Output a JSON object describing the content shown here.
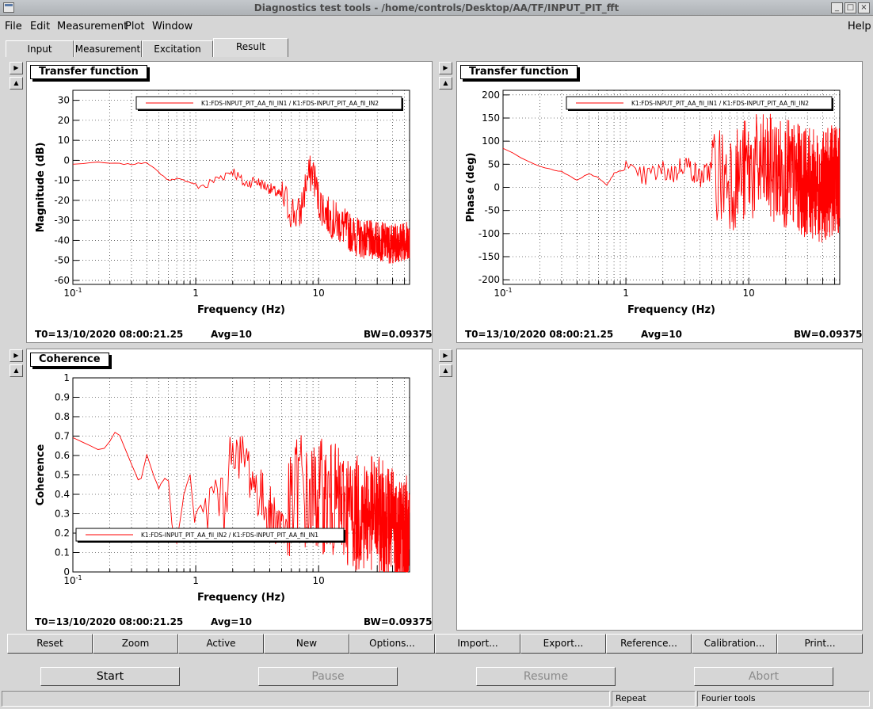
{
  "window": {
    "title": "Diagnostics test tools - /home/controls/Desktop/AA/TF/INPUT_PIT_fft"
  },
  "menu": {
    "file": "File",
    "edit": "Edit",
    "measurement": "Measurement",
    "plot": "Plot",
    "window": "Window",
    "help": "Help"
  },
  "tabs": [
    "Input",
    "Measurement",
    "Excitation",
    "Result"
  ],
  "panels": [
    {
      "label": "Transfer function",
      "t0": "T0=13/10/2020 08:00:21.25",
      "avg": "Avg=10",
      "bw": "BW=0.09375"
    },
    {
      "label": "Transfer function",
      "t0": "T0=13/10/2020 08:00:21.25",
      "avg": "Avg=10",
      "bw": "BW=0.09375"
    },
    {
      "label": "Coherence",
      "t0": "T0=13/10/2020 08:00:21.25",
      "avg": "Avg=10",
      "bw": "BW=0.09375"
    }
  ],
  "toolbar": [
    "Reset",
    "Zoom",
    "Active",
    "New",
    "Options...",
    "Import...",
    "Export...",
    "Reference...",
    "Calibration...",
    "Print..."
  ],
  "controls": {
    "start": "Start",
    "pause": "Pause",
    "resume": "Resume",
    "abort": "Abort"
  },
  "status": {
    "repeat": "Repeat",
    "tools": "Fourier tools"
  },
  "colors": {
    "trace": "#ff0000",
    "background": "#d6d6d6"
  },
  "chart_data": [
    {
      "type": "line",
      "xlabel": "Frequency (Hz)",
      "ylabel": "Magnitude (dB)",
      "xscale": "log",
      "xlim": [
        0.1,
        55
      ],
      "ylim": [
        -62,
        35
      ],
      "xticks": [
        "10-1",
        "1",
        "10"
      ],
      "yticks": [
        30,
        20,
        10,
        0,
        -10,
        -20,
        -30,
        -40,
        -50,
        -60
      ],
      "grid": true,
      "legend_position": "top-right",
      "series": [
        {
          "name": "K1:FDS-INPUT_PIT_AA_fil_IN1 / K1:FDS-INPUT_PIT_AA_fil_IN2",
          "x": [
            0.1,
            0.15,
            0.2,
            0.3,
            0.4,
            0.5,
            0.6,
            0.7,
            0.8,
            1.0,
            1.2,
            1.5,
            2.0,
            2.5,
            3.0,
            4.0,
            5.0,
            6.0,
            7.0,
            8.0,
            9.0,
            10,
            12,
            15,
            20,
            25,
            30,
            40,
            50
          ],
          "y": [
            -2,
            -1,
            -1.5,
            -2,
            -1,
            -6,
            -10,
            -9,
            -10,
            -12,
            -13,
            -9,
            -5,
            -12,
            -10,
            -14,
            -18,
            -25,
            -28,
            -10,
            -5,
            -20,
            -28,
            -32,
            -38,
            -40,
            -40,
            -42,
            -40
          ]
        }
      ]
    },
    {
      "type": "line",
      "xlabel": "Frequency (Hz)",
      "ylabel": "Phase (deg)",
      "xscale": "log",
      "xlim": [
        0.1,
        55
      ],
      "ylim": [
        -210,
        210
      ],
      "xticks": [
        "10-1",
        "1",
        "10"
      ],
      "yticks": [
        200,
        150,
        100,
        50,
        0,
        -50,
        -100,
        -150,
        -200
      ],
      "grid": true,
      "legend_position": "top-right",
      "series": [
        {
          "name": "K1:FDS-INPUT_PIT_AA_fil_IN1 / K1:FDS-INPUT_PIT_AA_fil_IN2",
          "x": [
            0.1,
            0.12,
            0.15,
            0.2,
            0.3,
            0.4,
            0.5,
            0.6,
            0.7,
            0.8,
            1.0,
            1.2,
            1.5,
            2.0,
            2.5,
            3.0,
            4.0,
            5.0,
            6.0,
            7.0,
            8.0,
            10,
            15,
            20,
            30,
            40,
            50
          ],
          "y": [
            85,
            75,
            60,
            45,
            35,
            15,
            30,
            20,
            5,
            30,
            40,
            20,
            25,
            35,
            30,
            55,
            20,
            40,
            20,
            30,
            20,
            40,
            40,
            30,
            10,
            0,
            20
          ]
        }
      ]
    },
    {
      "type": "line",
      "xlabel": "Frequency (Hz)",
      "ylabel": "Coherence",
      "xscale": "log",
      "xlim": [
        0.1,
        55
      ],
      "ylim": [
        0,
        1
      ],
      "xticks": [
        "10-1",
        "1",
        "10"
      ],
      "yticks": [
        1,
        0.9,
        0.8,
        0.7,
        0.6,
        0.5,
        0.4,
        0.3,
        0.2,
        0.1,
        0
      ],
      "grid": true,
      "legend_position": "bottom-left",
      "series": [
        {
          "name": "K1:FDS-INPUT_PIT_AA_fil_IN2 / K1:FDS-INPUT_PIT_AA_fil_IN1",
          "x": [
            0.1,
            0.17,
            0.23,
            0.35,
            0.4,
            0.45,
            0.5,
            0.55,
            0.6,
            0.65,
            0.7,
            0.8,
            0.9,
            1.0,
            1.2,
            1.5,
            1.7,
            2.0,
            2.2,
            2.5,
            3.0,
            4.0,
            5.0,
            6.0,
            7.0,
            8.0,
            10,
            15,
            20,
            30,
            40,
            50
          ],
          "y": [
            0.69,
            0.62,
            0.73,
            0.45,
            0.6,
            0.5,
            0.43,
            0.48,
            0.47,
            0.2,
            0.15,
            0.4,
            0.5,
            0.2,
            0.3,
            0.45,
            0.3,
            0.72,
            0.55,
            0.6,
            0.45,
            0.3,
            0.25,
            0.3,
            0.5,
            0.35,
            0.4,
            0.35,
            0.3,
            0.3,
            0.25,
            0.2
          ]
        }
      ]
    }
  ]
}
